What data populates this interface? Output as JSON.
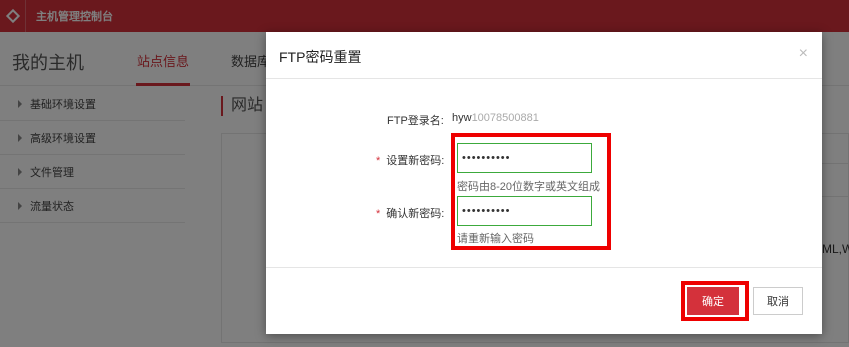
{
  "app": {
    "title": "主机管理控制台"
  },
  "tabs": {
    "main_title": "我的主机",
    "items": [
      {
        "label": "站点信息",
        "active": true
      },
      {
        "label": "数据库",
        "active": false
      }
    ]
  },
  "sidebar": {
    "items": [
      {
        "label": "基础环境设置"
      },
      {
        "label": "高级环境设置"
      },
      {
        "label": "文件管理"
      },
      {
        "label": "流量状态"
      }
    ]
  },
  "content": {
    "title": "网站",
    "side_text": "ML,W"
  },
  "modal": {
    "title": "FTP密码重置",
    "close_symbol": "×",
    "login_label": "FTP登录名:",
    "login_value_prefix": "hyw",
    "login_value_masked": "10078500881",
    "new_password_label": "设置新密码:",
    "new_password_value": "••••••••••",
    "new_password_hint": "密码由8-20位数字或英文组成",
    "confirm_password_label": "确认新密码:",
    "confirm_password_value": "••••••••••",
    "confirm_password_hint": "请重新输入密码",
    "required_mark": "*",
    "confirm_button": "确定",
    "cancel_button": "取消"
  },
  "colors": {
    "accent": "#d4313b",
    "highlight": "#e00000",
    "input_border": "#3caa3c"
  }
}
